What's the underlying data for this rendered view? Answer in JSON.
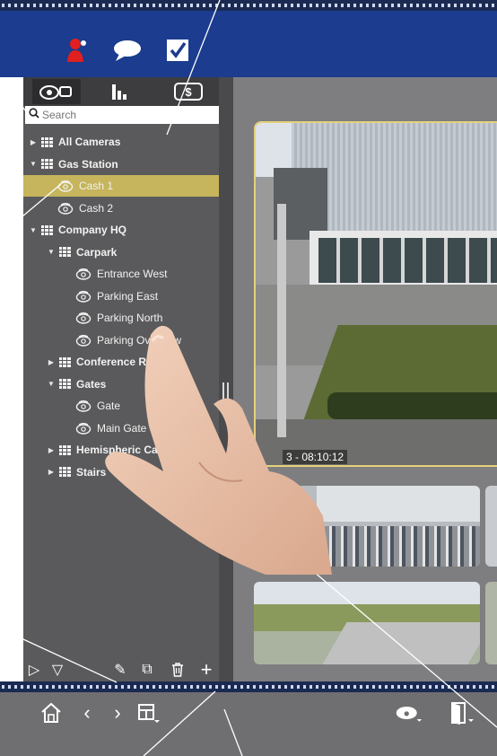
{
  "header": {
    "buttons": [
      {
        "name": "user-alarm",
        "icon": "person-alarm-icon",
        "color": "#e02020"
      },
      {
        "name": "chat",
        "icon": "speech-bubble-icon",
        "color": "#ffffff"
      },
      {
        "name": "checkbox",
        "icon": "checkbox-icon",
        "color": "#ffffff"
      }
    ]
  },
  "panel": {
    "tabs": [
      {
        "name": "cameras",
        "icon": "camera-group-icon",
        "active": true
      },
      {
        "name": "stats",
        "icon": "bar-chart-icon",
        "active": false
      },
      {
        "name": "dollar",
        "icon": "dollar-sign-icon",
        "active": false
      }
    ],
    "search": {
      "placeholder": "Search",
      "value": ""
    }
  },
  "tree": [
    {
      "label": "All Cameras",
      "type": "group",
      "level": 0,
      "expanded": false
    },
    {
      "label": "Gas Station",
      "type": "group",
      "level": 0,
      "expanded": true
    },
    {
      "label": "Cash 1",
      "type": "camera",
      "level": 1,
      "selected": true
    },
    {
      "label": "Cash 2",
      "type": "camera",
      "level": 1
    },
    {
      "label": "Company HQ",
      "type": "group",
      "level": 0,
      "expanded": true
    },
    {
      "label": "Carpark",
      "type": "group",
      "level": 1,
      "expanded": true
    },
    {
      "label": "Entrance West",
      "type": "camera",
      "level": 2
    },
    {
      "label": "Parking East",
      "type": "camera",
      "level": 2
    },
    {
      "label": "Parking North",
      "type": "camera",
      "level": 2
    },
    {
      "label": "Parking Overview",
      "type": "camera",
      "level": 2
    },
    {
      "label": "Conference Room",
      "type": "group",
      "level": 1,
      "expanded": false
    },
    {
      "label": "Gates",
      "type": "group",
      "level": 1,
      "expanded": true
    },
    {
      "label": "Gate",
      "type": "camera",
      "level": 2
    },
    {
      "label": "Main Gate",
      "type": "camera",
      "level": 2
    },
    {
      "label": "Hemispheric Cameras",
      "type": "group",
      "level": 1,
      "expanded": false
    },
    {
      "label": "Stairs",
      "type": "group",
      "level": 1,
      "expanded": false
    }
  ],
  "footer": {
    "play": "▷",
    "expand": "▽",
    "edit": "✎",
    "duplicate": "⧉",
    "delete": "🗑",
    "add": "+"
  },
  "video": {
    "timestamp": "3 - 08:10:12"
  },
  "bottom_bar": {
    "home": "⌂",
    "back": "‹",
    "forward": "›",
    "layout": "layout-icon",
    "camera_select": "dome-camera-icon",
    "exit": "door-exit-icon"
  },
  "colors": {
    "header": "#1b3c8f",
    "panel": "#5a5a5c",
    "selection": "#c6b55c",
    "frame_highlight": "#e3d27a"
  }
}
